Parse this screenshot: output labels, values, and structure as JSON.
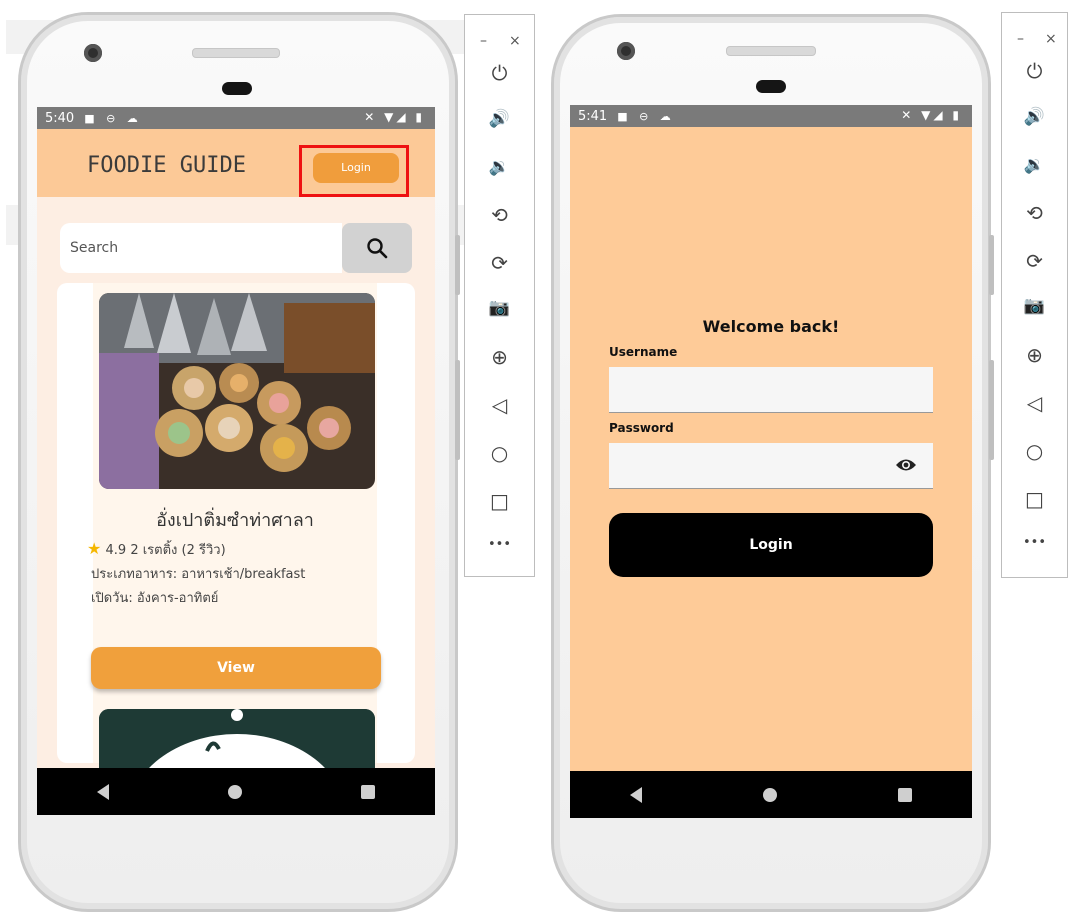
{
  "emulator": {
    "minimize_glyph": "–",
    "close_glyph": "×",
    "tools": [
      {
        "icon": "power-icon",
        "glyph": "⏻"
      },
      {
        "icon": "volume-up-icon",
        "glyph": "🔊"
      },
      {
        "icon": "volume-down-icon",
        "glyph": "🔉"
      },
      {
        "icon": "rotate-left-icon",
        "glyph": "⟲"
      },
      {
        "icon": "rotate-right-icon",
        "glyph": "⟳"
      },
      {
        "icon": "camera-icon",
        "glyph": "📷"
      },
      {
        "icon": "zoom-icon",
        "glyph": "⊕"
      },
      {
        "icon": "back-icon",
        "glyph": "◁"
      },
      {
        "icon": "home-icon",
        "glyph": "○"
      },
      {
        "icon": "overview-icon",
        "glyph": "□"
      },
      {
        "icon": "more-icon",
        "glyph": "•••"
      }
    ]
  },
  "phone_left": {
    "status_time": "5:40",
    "app_title": "FOODIE GUIDE",
    "login_label": "Login",
    "search_placeholder": "Search",
    "search_icon": "search-icon",
    "card": {
      "name": "อั่งเปาติ่มซำท่าศาลา",
      "rating": "4.9",
      "rating_text": "2 เรตติ้ง (2 รีวิว)",
      "food_type": "ประเภทอาหาร:  อาหารเช้า/breakfast",
      "open_days": "เปิดวัน: อังคาร-อาทิตย์",
      "view_label": "View"
    }
  },
  "phone_right": {
    "status_time": "5:41",
    "welcome": "Welcome back!",
    "username_label": "Username",
    "password_label": "Password",
    "login_label": "Login",
    "eye_icon": "eye-icon"
  },
  "colors": {
    "header_peach": "#fcc997",
    "login_bg": "#fecb98",
    "accent_orange": "#f09d3c",
    "highlight_red": "#ee1111"
  }
}
